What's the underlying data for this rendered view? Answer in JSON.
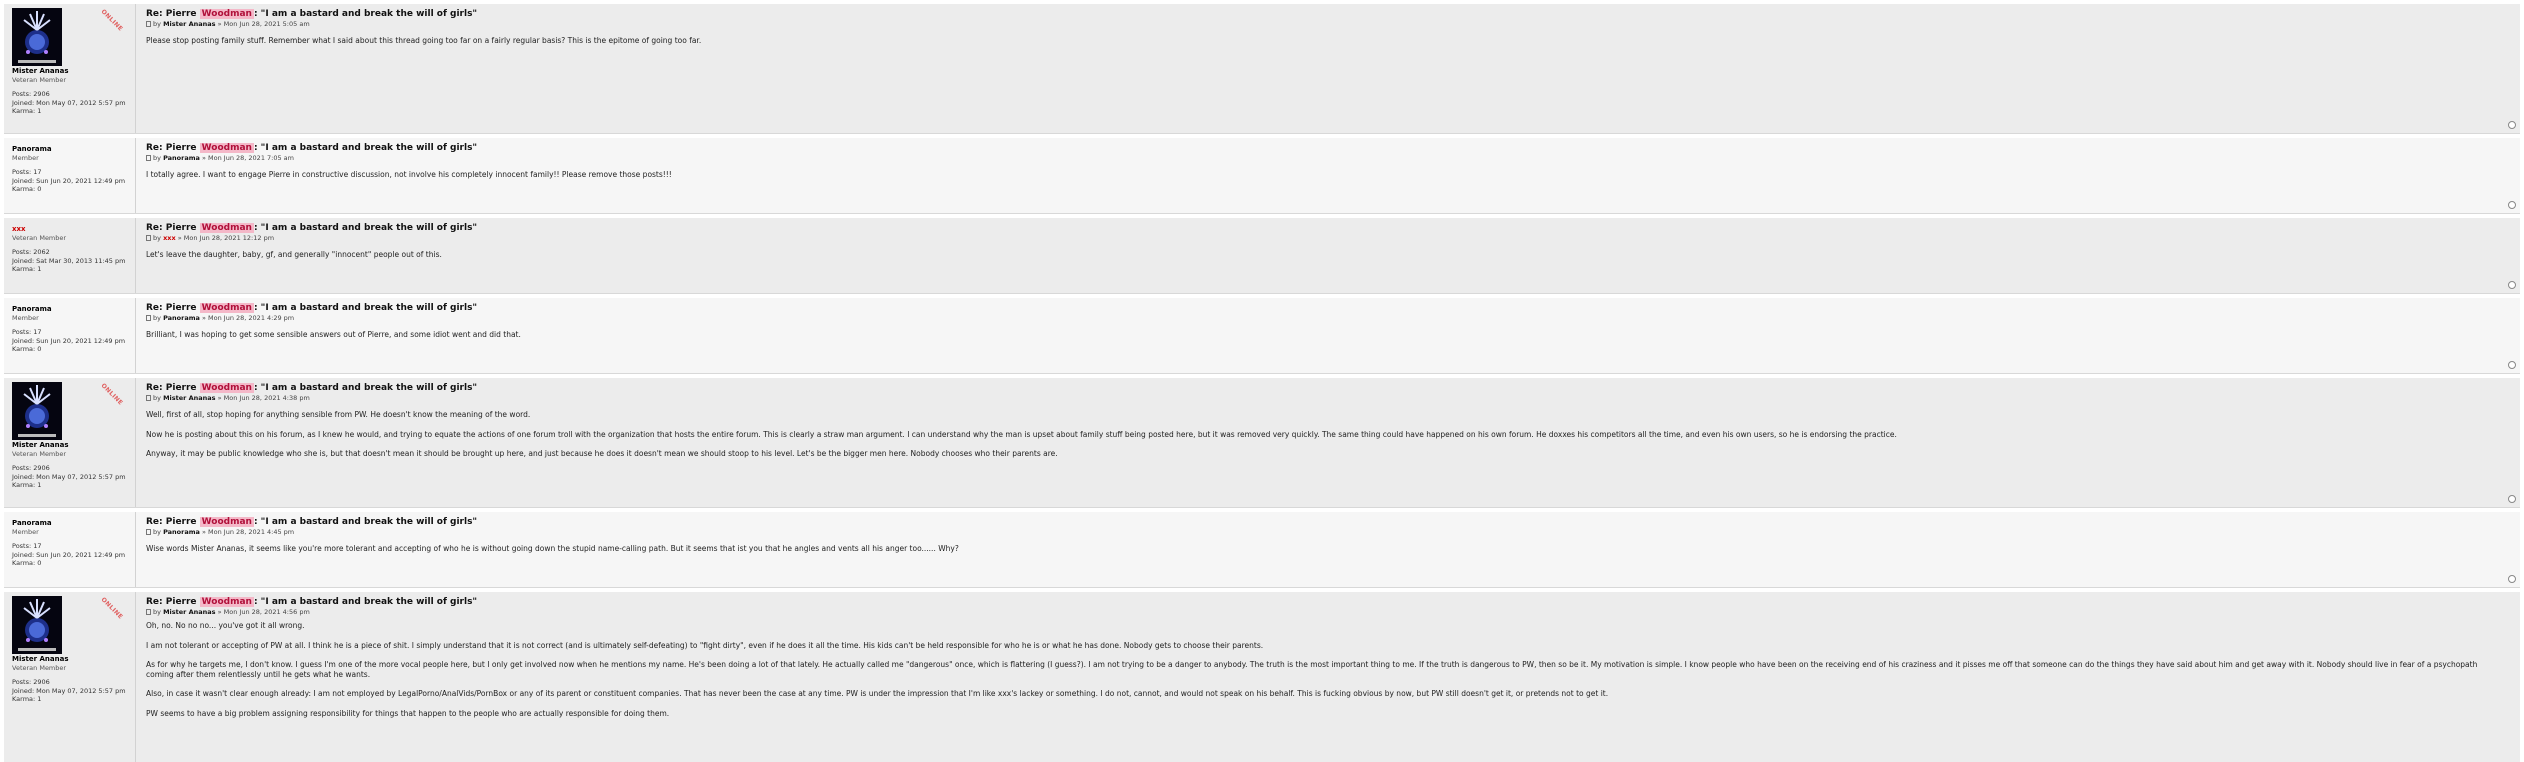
{
  "highlight": "Woodman",
  "posts": [
    {
      "title_pre": "Re: Pierre ",
      "title_post": ": \"I am a bastard and break the will of girls\"",
      "by": "by",
      "author": "Mister Ananas",
      "date": "» Mon Jun 28, 2021 5:05 am",
      "user": {
        "name": "Mister Ananas",
        "rank": "Veteran Member",
        "posts_label": "Posts:",
        "posts": "2906",
        "joined_label": "Joined:",
        "joined": "Mon May 07, 2012 5:57 pm",
        "karma_label": "Karma:",
        "karma": "1",
        "online": "ONLINE"
      },
      "paragraphs": [
        "Please stop posting family stuff. Remember what I said about this thread going too far on a fairly regular basis? This is the epitome of going too far."
      ]
    },
    {
      "title_pre": "Re: Pierre ",
      "title_post": ": \"I am a bastard and break the will of girls\"",
      "by": "by",
      "author": "Panorama",
      "date": "» Mon Jun 28, 2021 7:05 am",
      "user": {
        "name": "Panorama",
        "rank": "Member",
        "posts_label": "Posts:",
        "posts": "17",
        "joined_label": "Joined:",
        "joined": "Sun Jun 20, 2021 12:49 pm",
        "karma_label": "Karma:",
        "karma": "0"
      },
      "paragraphs": [
        "I totally agree. I want to engage Pierre in constructive discussion, not involve his completely innocent family!! Please remove those posts!!!"
      ]
    },
    {
      "title_pre": "Re: Pierre ",
      "title_post": ": \"I am a bastard and break the will of girls\"",
      "by": "by",
      "author": "xxx",
      "date": "» Mon Jun 28, 2021 12:12 pm",
      "user": {
        "name": "xxx",
        "rank": "Veteran Member",
        "posts_label": "Posts:",
        "posts": "2062",
        "joined_label": "Joined:",
        "joined": "Sat Mar 30, 2013 11:45 pm",
        "karma_label": "Karma:",
        "karma": "1"
      },
      "paragraphs": [
        "Let's leave the daughter, baby, gf, and generally \"innocent\" people out of this."
      ]
    },
    {
      "title_pre": "Re: Pierre ",
      "title_post": ": \"I am a bastard and break the will of girls\"",
      "by": "by",
      "author": "Panorama",
      "date": "» Mon Jun 28, 2021 4:29 pm",
      "user": {
        "name": "Panorama",
        "rank": "Member",
        "posts_label": "Posts:",
        "posts": "17",
        "joined_label": "Joined:",
        "joined": "Sun Jun 20, 2021 12:49 pm",
        "karma_label": "Karma:",
        "karma": "0"
      },
      "paragraphs": [
        "Brilliant, I was hoping to get some sensible answers out of Pierre, and some idiot went and did that."
      ]
    },
    {
      "title_pre": "Re: Pierre ",
      "title_post": ": \"I am a bastard and break the will of girls\"",
      "by": "by",
      "author": "Mister Ananas",
      "date": "» Mon Jun 28, 2021 4:38 pm",
      "user": {
        "name": "Mister Ananas",
        "rank": "Veteran Member",
        "posts_label": "Posts:",
        "posts": "2906",
        "joined_label": "Joined:",
        "joined": "Mon May 07, 2012 5:57 pm",
        "karma_label": "Karma:",
        "karma": "1",
        "online": "ONLINE"
      },
      "paragraphs": [
        "Well, first of all, stop hoping for anything sensible from PW. He doesn't know the meaning of the word.",
        "Now he is posting about this on his forum, as I knew he would, and trying to equate the actions of one forum troll with the organization that hosts the entire forum. This is clearly a straw man argument. I can understand why the man is upset about family stuff being posted here, but it was removed very quickly. The same thing could have happened on his own forum. He doxxes his competitors all the time, and even his own users, so he is endorsing the practice.",
        "Anyway, it may be public knowledge who she is, but that doesn't mean it should be brought up here, and just because he does it doesn't mean we should stoop to his level. Let's be the bigger men here. Nobody chooses who their parents are."
      ]
    },
    {
      "title_pre": "Re: Pierre ",
      "title_post": ": \"I am a bastard and break the will of girls\"",
      "by": "by",
      "author": "Panorama",
      "date": "» Mon Jun 28, 2021 4:45 pm",
      "user": {
        "name": "Panorama",
        "rank": "Member",
        "posts_label": "Posts:",
        "posts": "17",
        "joined_label": "Joined:",
        "joined": "Sun Jun 20, 2021 12:49 pm",
        "karma_label": "Karma:",
        "karma": "0"
      },
      "paragraphs": [
        "Wise words Mister Ananas, it seems like you're more tolerant and accepting of who he is without going down the stupid name-calling path. But it seems that ist you that he angles and vents all his anger too...... Why?"
      ]
    },
    {
      "title_pre": "Re: Pierre ",
      "title_post": ": \"I am a bastard and break the will of girls\"",
      "by": "by",
      "author": "Mister Ananas",
      "date": "» Mon Jun 28, 2021 4:56 pm",
      "user": {
        "name": "Mister Ananas",
        "rank": "Veteran Member",
        "posts_label": "Posts:",
        "posts": "2906",
        "joined_label": "Joined:",
        "joined": "Mon May 07, 2012 5:57 pm",
        "karma_label": "Karma:",
        "karma": "1",
        "online": "ONLINE"
      },
      "paragraphs": [
        "Oh, no. No no no... you've got it all wrong.",
        "I am not tolerant or accepting of PW at all. I think he is a piece of shit. I simply understand that it is not correct (and is ultimately self-defeating) to \"fight dirty\", even if he does it all the time. His kids can't be held responsible for who he is or what he has done. Nobody gets to choose their parents.",
        "As for why he targets me, I don't know. I guess I'm one of the more vocal people here, but I only get involved now when he mentions my name. He's been doing a lot of that lately. He actually called me \"dangerous\" once, which is flattering (I guess?). I am not trying to be a danger to anybody. The truth is the most important thing to me. If the truth is dangerous to PW, then so be it. My motivation is simple. I know people who have been on the receiving end of his craziness and it pisses me off that someone can do the things they have said about him and get away with it. Nobody should live in fear of a psychopath coming after them relentlessly until he gets what he wants.",
        "Also, in case it wasn't clear enough already: I am not employed by LegalPorno/AnalVids/PornBox or any of its parent or constituent companies. That has never been the case at any time. PW is under the impression that I'm like xxx's lackey or something. I do not, cannot, and would not speak on his behalf. This is fucking obvious by now, but PW still doesn't get it, or pretends not to get it.",
        "PW seems to have a big problem assigning responsibility for things that happen to the people who are actually responsible for doing them."
      ]
    }
  ]
}
